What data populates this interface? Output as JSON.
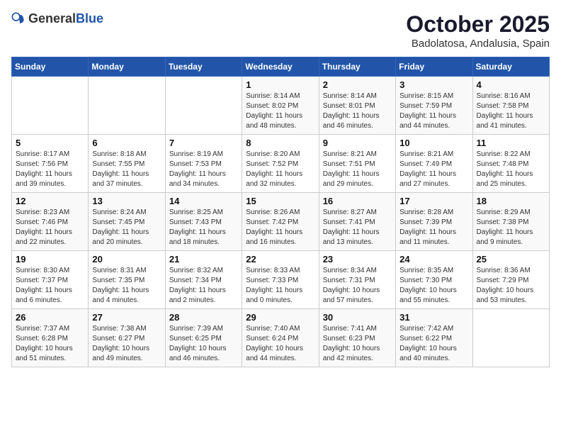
{
  "header": {
    "logo_general": "General",
    "logo_blue": "Blue",
    "month": "October 2025",
    "location": "Badolatosa, Andalusia, Spain"
  },
  "days_of_week": [
    "Sunday",
    "Monday",
    "Tuesday",
    "Wednesday",
    "Thursday",
    "Friday",
    "Saturday"
  ],
  "weeks": [
    [
      {
        "day": "",
        "info": ""
      },
      {
        "day": "",
        "info": ""
      },
      {
        "day": "",
        "info": ""
      },
      {
        "day": "1",
        "info": "Sunrise: 8:14 AM\nSunset: 8:02 PM\nDaylight: 11 hours and 48 minutes."
      },
      {
        "day": "2",
        "info": "Sunrise: 8:14 AM\nSunset: 8:01 PM\nDaylight: 11 hours and 46 minutes."
      },
      {
        "day": "3",
        "info": "Sunrise: 8:15 AM\nSunset: 7:59 PM\nDaylight: 11 hours and 44 minutes."
      },
      {
        "day": "4",
        "info": "Sunrise: 8:16 AM\nSunset: 7:58 PM\nDaylight: 11 hours and 41 minutes."
      }
    ],
    [
      {
        "day": "5",
        "info": "Sunrise: 8:17 AM\nSunset: 7:56 PM\nDaylight: 11 hours and 39 minutes."
      },
      {
        "day": "6",
        "info": "Sunrise: 8:18 AM\nSunset: 7:55 PM\nDaylight: 11 hours and 37 minutes."
      },
      {
        "day": "7",
        "info": "Sunrise: 8:19 AM\nSunset: 7:53 PM\nDaylight: 11 hours and 34 minutes."
      },
      {
        "day": "8",
        "info": "Sunrise: 8:20 AM\nSunset: 7:52 PM\nDaylight: 11 hours and 32 minutes."
      },
      {
        "day": "9",
        "info": "Sunrise: 8:21 AM\nSunset: 7:51 PM\nDaylight: 11 hours and 29 minutes."
      },
      {
        "day": "10",
        "info": "Sunrise: 8:21 AM\nSunset: 7:49 PM\nDaylight: 11 hours and 27 minutes."
      },
      {
        "day": "11",
        "info": "Sunrise: 8:22 AM\nSunset: 7:48 PM\nDaylight: 11 hours and 25 minutes."
      }
    ],
    [
      {
        "day": "12",
        "info": "Sunrise: 8:23 AM\nSunset: 7:46 PM\nDaylight: 11 hours and 22 minutes."
      },
      {
        "day": "13",
        "info": "Sunrise: 8:24 AM\nSunset: 7:45 PM\nDaylight: 11 hours and 20 minutes."
      },
      {
        "day": "14",
        "info": "Sunrise: 8:25 AM\nSunset: 7:43 PM\nDaylight: 11 hours and 18 minutes."
      },
      {
        "day": "15",
        "info": "Sunrise: 8:26 AM\nSunset: 7:42 PM\nDaylight: 11 hours and 16 minutes."
      },
      {
        "day": "16",
        "info": "Sunrise: 8:27 AM\nSunset: 7:41 PM\nDaylight: 11 hours and 13 minutes."
      },
      {
        "day": "17",
        "info": "Sunrise: 8:28 AM\nSunset: 7:39 PM\nDaylight: 11 hours and 11 minutes."
      },
      {
        "day": "18",
        "info": "Sunrise: 8:29 AM\nSunset: 7:38 PM\nDaylight: 11 hours and 9 minutes."
      }
    ],
    [
      {
        "day": "19",
        "info": "Sunrise: 8:30 AM\nSunset: 7:37 PM\nDaylight: 11 hours and 6 minutes."
      },
      {
        "day": "20",
        "info": "Sunrise: 8:31 AM\nSunset: 7:35 PM\nDaylight: 11 hours and 4 minutes."
      },
      {
        "day": "21",
        "info": "Sunrise: 8:32 AM\nSunset: 7:34 PM\nDaylight: 11 hours and 2 minutes."
      },
      {
        "day": "22",
        "info": "Sunrise: 8:33 AM\nSunset: 7:33 PM\nDaylight: 11 hours and 0 minutes."
      },
      {
        "day": "23",
        "info": "Sunrise: 8:34 AM\nSunset: 7:31 PM\nDaylight: 10 hours and 57 minutes."
      },
      {
        "day": "24",
        "info": "Sunrise: 8:35 AM\nSunset: 7:30 PM\nDaylight: 10 hours and 55 minutes."
      },
      {
        "day": "25",
        "info": "Sunrise: 8:36 AM\nSunset: 7:29 PM\nDaylight: 10 hours and 53 minutes."
      }
    ],
    [
      {
        "day": "26",
        "info": "Sunrise: 7:37 AM\nSunset: 6:28 PM\nDaylight: 10 hours and 51 minutes."
      },
      {
        "day": "27",
        "info": "Sunrise: 7:38 AM\nSunset: 6:27 PM\nDaylight: 10 hours and 49 minutes."
      },
      {
        "day": "28",
        "info": "Sunrise: 7:39 AM\nSunset: 6:25 PM\nDaylight: 10 hours and 46 minutes."
      },
      {
        "day": "29",
        "info": "Sunrise: 7:40 AM\nSunset: 6:24 PM\nDaylight: 10 hours and 44 minutes."
      },
      {
        "day": "30",
        "info": "Sunrise: 7:41 AM\nSunset: 6:23 PM\nDaylight: 10 hours and 42 minutes."
      },
      {
        "day": "31",
        "info": "Sunrise: 7:42 AM\nSunset: 6:22 PM\nDaylight: 10 hours and 40 minutes."
      },
      {
        "day": "",
        "info": ""
      }
    ]
  ]
}
